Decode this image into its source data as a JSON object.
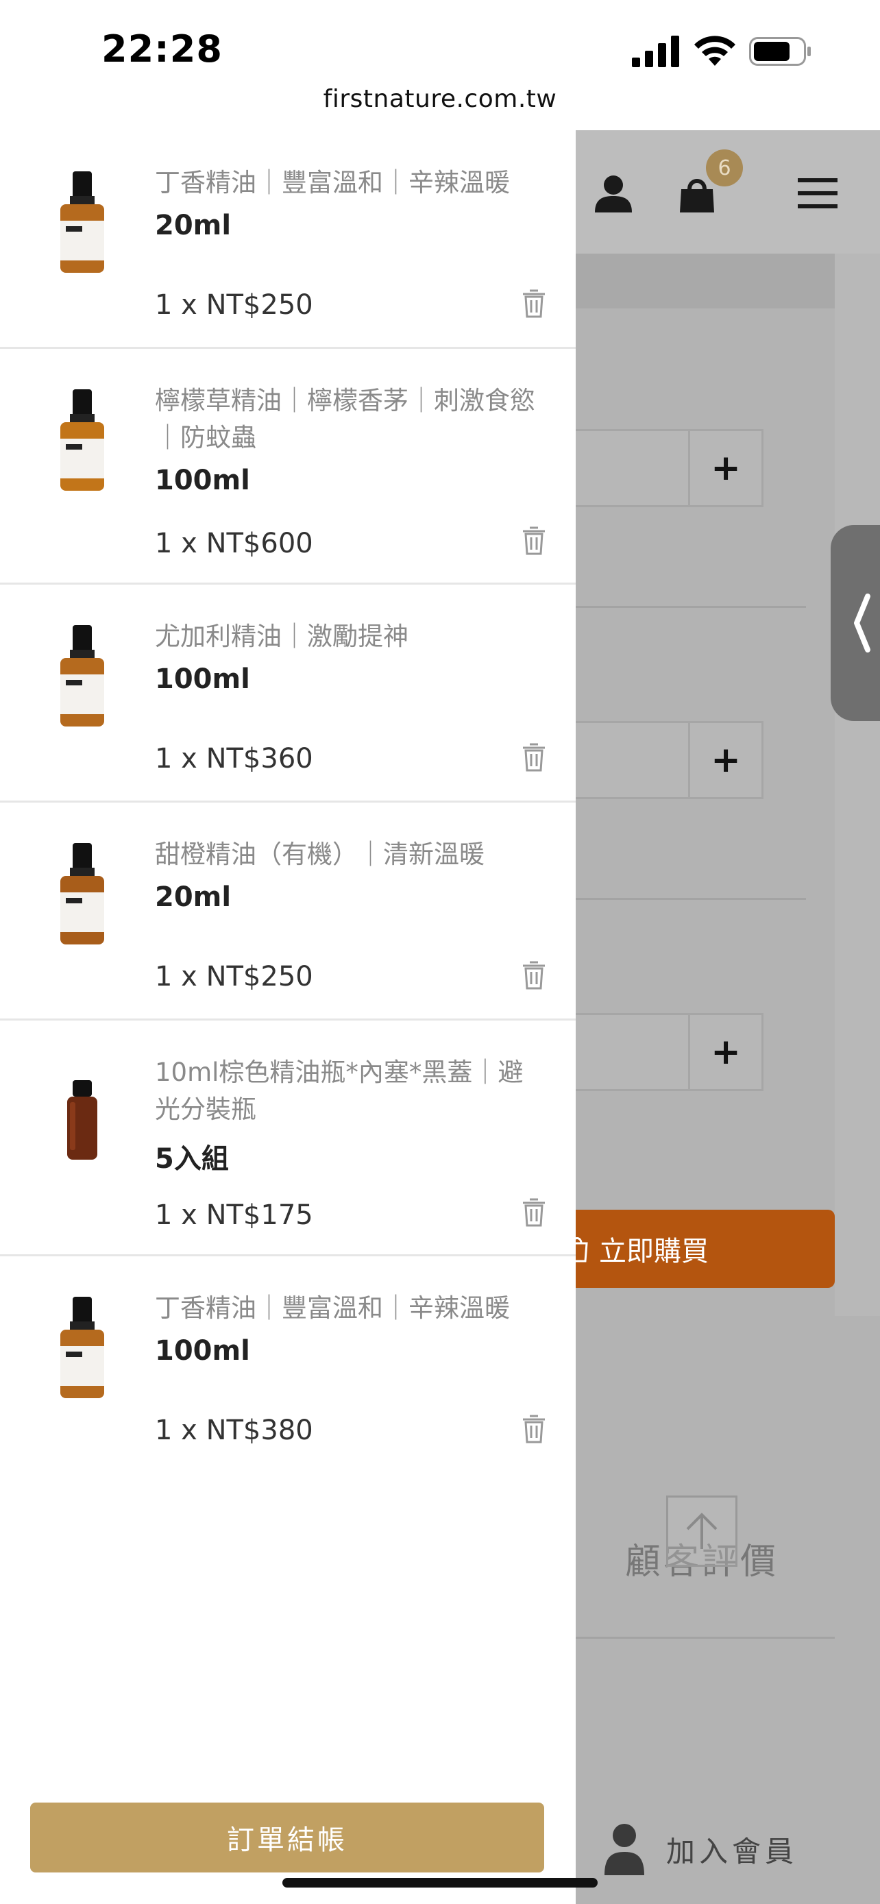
{
  "status_bar": {
    "time": "22:28",
    "url": "firstnature.com.tw"
  },
  "background_page": {
    "cart_count": "6",
    "buy_now_label": "立即購買",
    "reviews_label": "顧客評價",
    "join_member_label": "加入會員",
    "plus_label": "+"
  },
  "cart": {
    "items": [
      {
        "name": "丁香精油｜豐富溫和｜辛辣溫暖",
        "variant": "20ml",
        "qty": "1 x",
        "price": "NT$250"
      },
      {
        "name": "檸檬草精油｜檸檬香茅｜刺激食慾｜防蚊蟲",
        "variant": "100ml",
        "qty": "1 x",
        "price": "NT$600"
      },
      {
        "name": "尤加利精油｜激勵提神",
        "variant": "100ml",
        "qty": "1 x",
        "price": "NT$360"
      },
      {
        "name": "甜橙精油（有機）｜清新溫暖",
        "variant": "20ml",
        "qty": "1 x",
        "price": "NT$250"
      },
      {
        "name": "10ml棕色精油瓶*內塞*黑蓋｜避光分裝瓶",
        "variant": "5入組",
        "qty": "1 x",
        "price": "NT$175"
      },
      {
        "name": "丁香精油｜豐富溫和｜辛辣溫暖",
        "variant": "100ml",
        "qty": "1 x",
        "price": "NT$380"
      }
    ],
    "checkout_label": "訂單結帳"
  },
  "colors": {
    "checkout": "#c1a062",
    "buy_now": "#b4550f",
    "badge": "#a88a55"
  }
}
